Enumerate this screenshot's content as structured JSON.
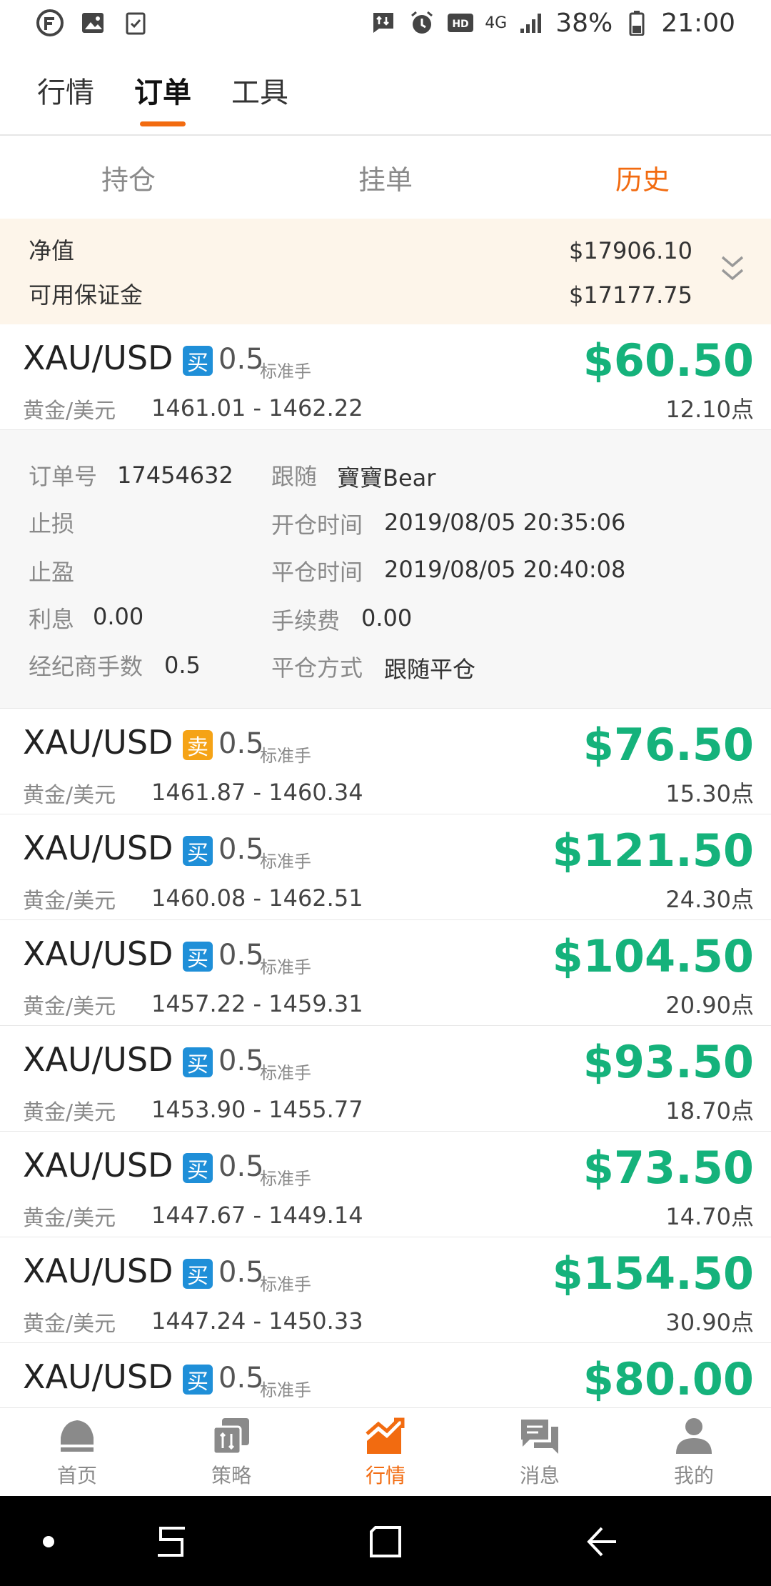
{
  "status_bar": {
    "network": "4G",
    "battery": "38%",
    "time": "21:00"
  },
  "top_tabs": [
    "行情",
    "订单",
    "工具"
  ],
  "top_tab_active": 1,
  "sub_tabs": [
    "持仓",
    "挂单",
    "历史"
  ],
  "sub_tab_active": 2,
  "equity": {
    "net_label": "净值",
    "net_value": "$17906.10",
    "margin_label": "可用保证金",
    "margin_value": "$17177.75"
  },
  "trades": [
    {
      "symbol": "XAU/USD",
      "side": "买",
      "side_type": "buy",
      "lots": "0.5",
      "unit": "标准手",
      "name": "黄金/美元",
      "range": "1461.01 - 1462.22",
      "profit": "$60.50",
      "points": "12.10点"
    },
    {
      "symbol": "XAU/USD",
      "side": "卖",
      "side_type": "sell",
      "lots": "0.5",
      "unit": "标准手",
      "name": "黄金/美元",
      "range": "1461.87 - 1460.34",
      "profit": "$76.50",
      "points": "15.30点"
    },
    {
      "symbol": "XAU/USD",
      "side": "买",
      "side_type": "buy",
      "lots": "0.5",
      "unit": "标准手",
      "name": "黄金/美元",
      "range": "1460.08 - 1462.51",
      "profit": "$121.50",
      "points": "24.30点"
    },
    {
      "symbol": "XAU/USD",
      "side": "买",
      "side_type": "buy",
      "lots": "0.5",
      "unit": "标准手",
      "name": "黄金/美元",
      "range": "1457.22 - 1459.31",
      "profit": "$104.50",
      "points": "20.90点"
    },
    {
      "symbol": "XAU/USD",
      "side": "买",
      "side_type": "buy",
      "lots": "0.5",
      "unit": "标准手",
      "name": "黄金/美元",
      "range": "1453.90 - 1455.77",
      "profit": "$93.50",
      "points": "18.70点"
    },
    {
      "symbol": "XAU/USD",
      "side": "买",
      "side_type": "buy",
      "lots": "0.5",
      "unit": "标准手",
      "name": "黄金/美元",
      "range": "1447.67 - 1449.14",
      "profit": "$73.50",
      "points": "14.70点"
    },
    {
      "symbol": "XAU/USD",
      "side": "买",
      "side_type": "buy",
      "lots": "0.5",
      "unit": "标准手",
      "name": "黄金/美元",
      "range": "1447.24 - 1450.33",
      "profit": "$154.50",
      "points": "30.90点"
    },
    {
      "symbol": "XAU/USD",
      "side": "买",
      "side_type": "buy",
      "lots": "0.5",
      "unit": "标准手",
      "name": "",
      "range": "",
      "profit": "$80.00",
      "points": ""
    }
  ],
  "detail": {
    "order_no_label": "订单号",
    "order_no": "17454632",
    "follow_label": "跟随",
    "follow": "寶寶Bear",
    "stop_loss_label": "止损",
    "open_time_label": "开仓时间",
    "open_time": "2019/08/05 20:35:06",
    "take_profit_label": "止盈",
    "close_time_label": "平仓时间",
    "close_time": "2019/08/05 20:40:08",
    "interest_label": "利息",
    "interest": "0.00",
    "fee_label": "手续费",
    "fee": "0.00",
    "broker_lots_label": "经纪商手数",
    "broker_lots": "0.5",
    "close_method_label": "平仓方式",
    "close_method": "跟随平仓"
  },
  "bottom_nav": [
    {
      "label": "首页",
      "icon": "home-icon"
    },
    {
      "label": "策略",
      "icon": "strategy-icon"
    },
    {
      "label": "行情",
      "icon": "market-icon"
    },
    {
      "label": "消息",
      "icon": "messages-icon"
    },
    {
      "label": "我的",
      "icon": "profile-icon"
    }
  ],
  "bottom_nav_active": 2,
  "colors": {
    "accent": "#f26b10",
    "profit": "#15b27b",
    "buy": "#1f8fd8",
    "sell": "#f5a316"
  }
}
